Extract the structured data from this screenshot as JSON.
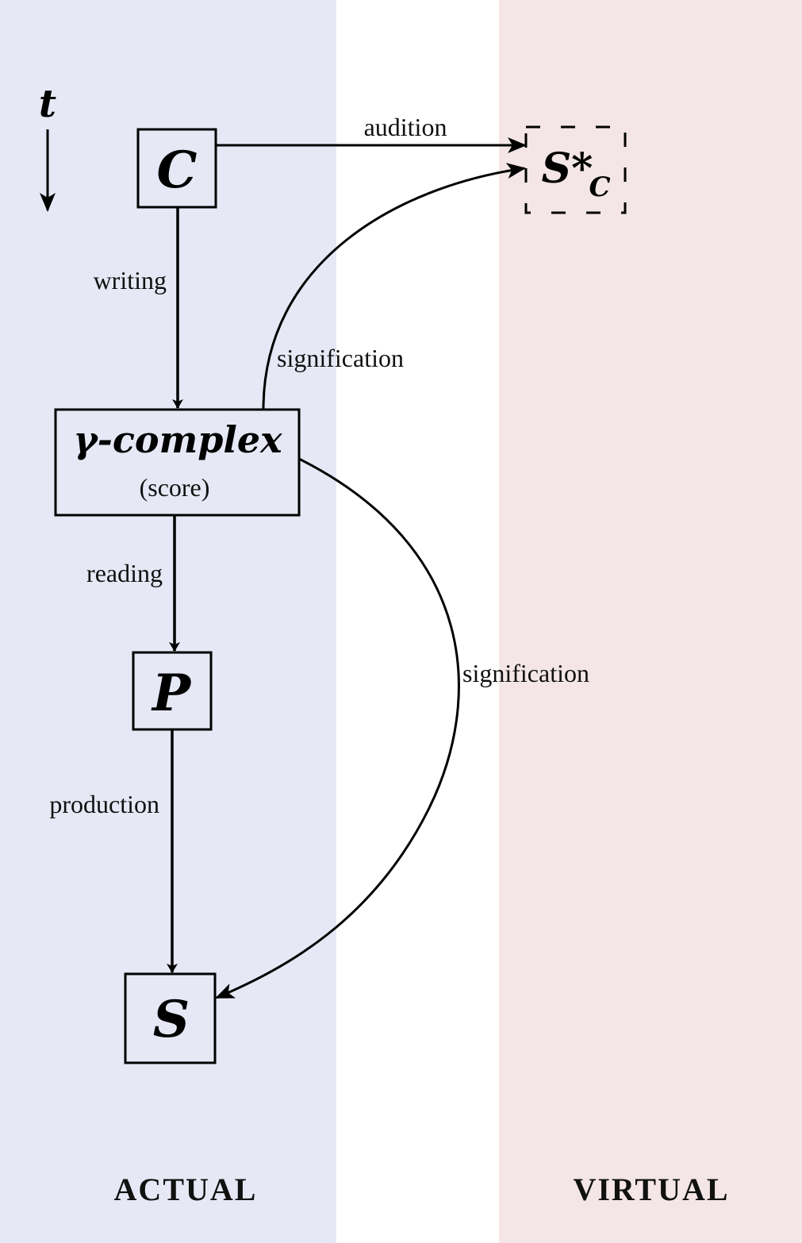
{
  "colors": {
    "actual_bg": "#e6e8f5",
    "virtual_bg": "#f4e6e6",
    "stroke": "#000000"
  },
  "regions": {
    "actual": "ACTUAL",
    "virtual": "VIRTUAL"
  },
  "time_axis": {
    "label": "t"
  },
  "nodes": {
    "composer": "C",
    "score_title": "γ-complex",
    "score_subtitle": "(score)",
    "performer": "P",
    "sound": "S",
    "virtual_sound": "S*",
    "virtual_sound_sub": "C"
  },
  "edges": {
    "audition": "audition",
    "writing": "writing",
    "signification_upper": "signification",
    "reading": "reading",
    "signification_lower": "signification",
    "production": "production"
  }
}
